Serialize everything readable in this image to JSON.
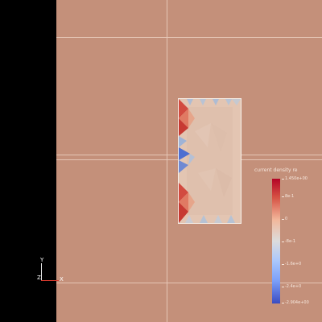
{
  "legend": {
    "title": "current density re",
    "labels": [
      "1.450e+00",
      "8e-1",
      "0",
      "-8e-1",
      "-1.6e+0",
      "-2.4e+0",
      "-2.904e+00"
    ]
  },
  "axes": {
    "y_label": "Y",
    "z_label": "Z",
    "x_label": "X"
  },
  "colors": {
    "background": "#c4907a",
    "left_panel": "#000000",
    "grid_line": "#e7c8b8",
    "colormap_top": "#b40426",
    "colormap_mid": "#dcdcdc",
    "colormap_bottom": "#3b4cc0"
  }
}
